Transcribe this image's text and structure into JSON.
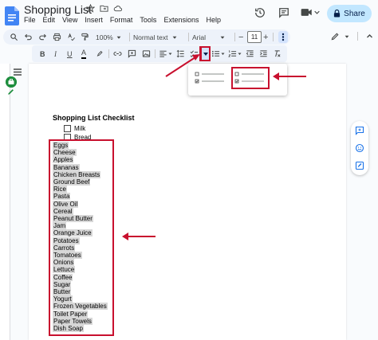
{
  "document": {
    "title": "Shopping List"
  },
  "menu": [
    "File",
    "Edit",
    "View",
    "Insert",
    "Format",
    "Tools",
    "Extensions",
    "Help"
  ],
  "header": {
    "share_label": "Share"
  },
  "toolbar": {
    "zoom": "100%",
    "style": "Normal text",
    "font": "Arial",
    "font_size": "11",
    "decrease_symbol": "−",
    "increase_symbol": "+"
  },
  "content": {
    "heading": "Shopping List Checklist",
    "checklist": [
      "Milk",
      "Bread"
    ],
    "list": [
      "Eggs",
      "Cheese",
      "Apples",
      "Bananas",
      "Chicken Breasts",
      "Ground Beef",
      "Rice",
      "Pasta",
      "Olive Oil",
      "Cereal",
      "Peanut Butter",
      "Jam",
      "Orange Juice",
      "Potatoes",
      "Carrots",
      "Tomatoes",
      "Onions",
      "Lettuce",
      "Coffee",
      "Sugar",
      "Butter",
      "Yogurt",
      "Frozen Vegetables",
      "Toilet Paper",
      "Paper Towels",
      "Dish Soap"
    ]
  },
  "colors": {
    "accent": "#1a73e8",
    "annotation": "#c8102e",
    "share_bg": "#c2e7ff",
    "highlight": "#d7d7d7"
  }
}
